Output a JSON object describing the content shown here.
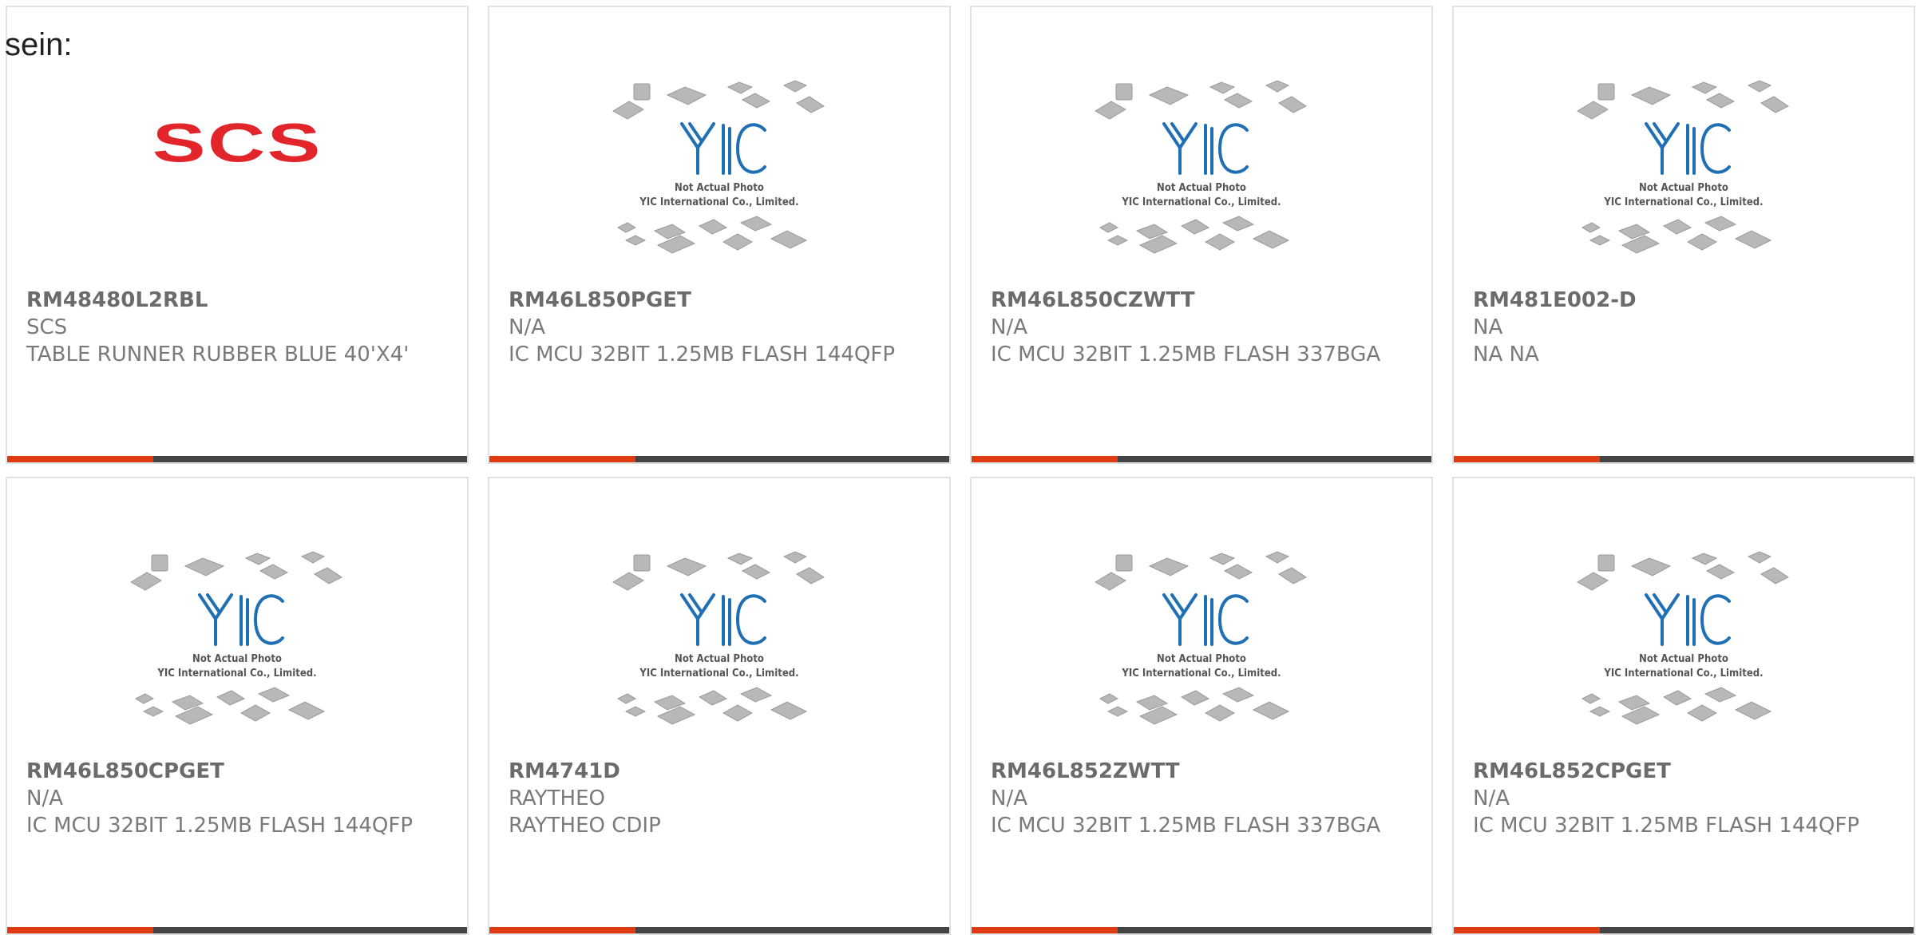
{
  "page": {
    "lead_text": "sein:"
  },
  "colors": {
    "accent": "#e03a12",
    "bar_dark": "#444444",
    "scs_red": "#e2252b",
    "yic_blue": "#1f6fb5"
  },
  "placeholder": {
    "line1": "Not Actual Photo",
    "line2": "YIC International Co., Limited."
  },
  "products": [
    {
      "part_number": "RM48480L2RBL",
      "manufacturer": "SCS",
      "description": "TABLE RUNNER RUBBER BLUE 40'X4'",
      "image": "SCS"
    },
    {
      "part_number": "RM46L850PGET",
      "manufacturer": "N/A",
      "description": "IC MCU 32BIT 1.25MB FLASH 144QFP",
      "image": ""
    },
    {
      "part_number": "RM46L850CZWTT",
      "manufacturer": "N/A",
      "description": "IC MCU 32BIT 1.25MB FLASH 337BGA",
      "image": ""
    },
    {
      "part_number": "RM481E002-D",
      "manufacturer": "NA",
      "description": "NA NA",
      "image": ""
    },
    {
      "part_number": "RM46L850CPGET",
      "manufacturer": "N/A",
      "description": "IC MCU 32BIT 1.25MB FLASH 144QFP",
      "image": ""
    },
    {
      "part_number": "RM4741D",
      "manufacturer": "RAYTHEO",
      "description": "RAYTHEO CDIP",
      "image": ""
    },
    {
      "part_number": "RM46L852ZWTT",
      "manufacturer": "N/A",
      "description": "IC MCU 32BIT 1.25MB FLASH 337BGA",
      "image": ""
    },
    {
      "part_number": "RM46L852CPGET",
      "manufacturer": "N/A",
      "description": "IC MCU 32BIT 1.25MB FLASH 144QFP",
      "image": ""
    }
  ]
}
